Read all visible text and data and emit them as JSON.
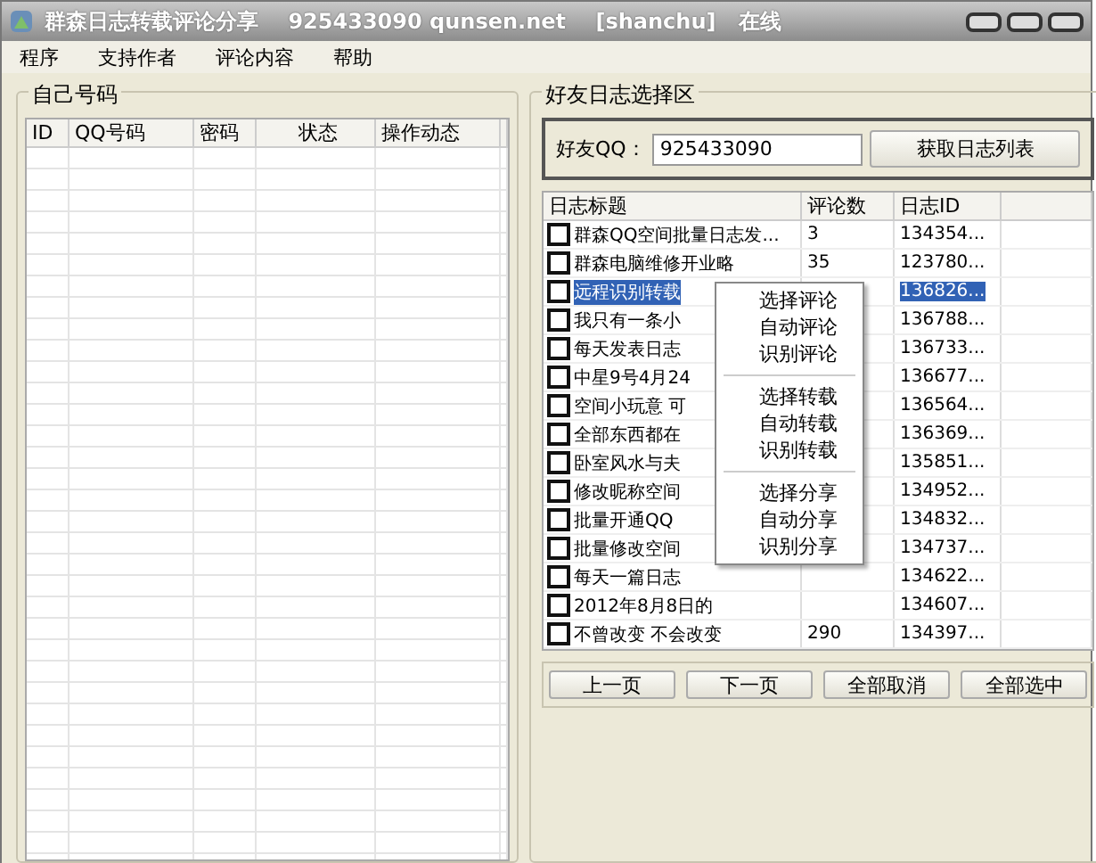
{
  "window": {
    "title": "群森日志转载评论分享    925433090 qunsen.net    [shanchu]   在线"
  },
  "menu_bar": [
    "程序",
    "支持作者",
    "评论内容",
    "帮助"
  ],
  "own_accounts": {
    "title": "自己号码",
    "columns": [
      "ID",
      "QQ号码",
      "密码",
      "状态",
      "操作动态"
    ]
  },
  "friend_logs": {
    "title": "好友日志选择区",
    "friend_qq_label": "好友QQ：",
    "friend_qq": "925433090",
    "fetch_button": "获取日志列表",
    "columns": [
      "日志标题",
      "评论数",
      "日志ID"
    ],
    "rows": [
      {
        "title": "群森QQ空间批量日志发...",
        "comments": "3",
        "id": "134354...",
        "checked": false,
        "selected": false
      },
      {
        "title": "群森电脑维修开业略",
        "comments": "35",
        "id": "123780...",
        "checked": false,
        "selected": false
      },
      {
        "title": "远程识别转载",
        "id": "136826...",
        "checked": false,
        "selected": true
      },
      {
        "title": "我只有一条小",
        "id": "136788...",
        "checked": false,
        "selected": false
      },
      {
        "title": "每天发表日志",
        "id": "136733...",
        "checked": false,
        "selected": false
      },
      {
        "title": "中星9号4月24",
        "id": "136677...",
        "checked": false,
        "selected": false
      },
      {
        "title": "空间小玩意 可",
        "id": "136564...",
        "checked": false,
        "selected": false
      },
      {
        "title": "全部东西都在",
        "id": "136369...",
        "checked": false,
        "selected": false
      },
      {
        "title": "卧室风水与夫",
        "id": "135851...",
        "checked": false,
        "selected": false
      },
      {
        "title": "修改昵称空间",
        "id": "134952...",
        "checked": false,
        "selected": false
      },
      {
        "title": "批量开通QQ",
        "id": "134832...",
        "checked": false,
        "selected": false
      },
      {
        "title": "批量修改空间",
        "id": "134737...",
        "checked": false,
        "selected": false
      },
      {
        "title": "每天一篇日志",
        "id": "134622...",
        "checked": false,
        "selected": false
      },
      {
        "title": "2012年8月8日的",
        "id": "134607...",
        "checked": false,
        "selected": false
      },
      {
        "title": "不曾改变 不会改变",
        "comments": "290",
        "id": "134397...",
        "checked": false,
        "selected": false
      }
    ],
    "buttons": [
      "上一页",
      "下一页",
      "全部取消",
      "全部选中"
    ]
  },
  "context_menu": [
    [
      "选择评论",
      "自动评论",
      "识别评论"
    ],
    [
      "选择转载",
      "自动转载",
      "识别转载"
    ],
    [
      "选择分享",
      "自动分享",
      "识别分享"
    ]
  ]
}
